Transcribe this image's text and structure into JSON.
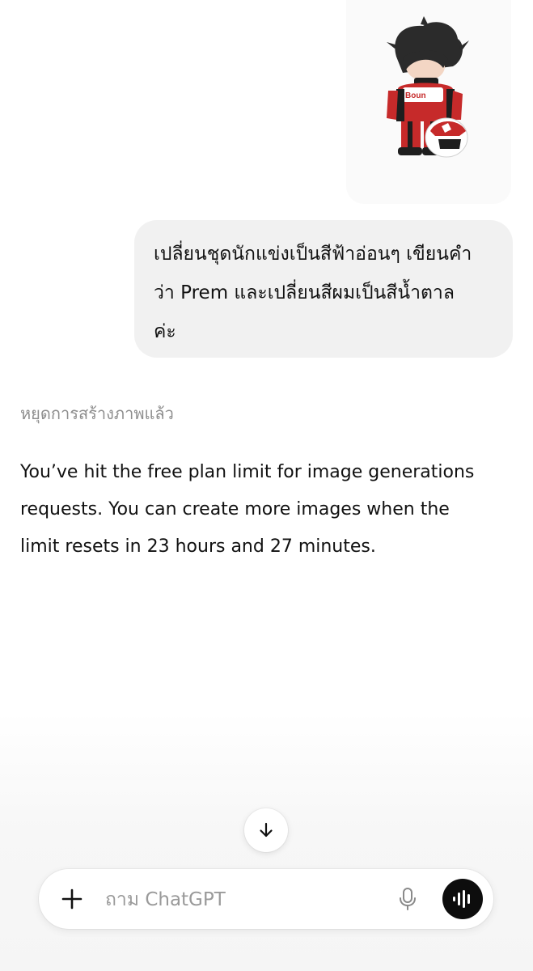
{
  "attachment": {
    "icon": "racer-sticker-image",
    "jersey_text": "Boun"
  },
  "user_message": {
    "lines": [
      "เปลี่ยนชุดนักแข่งเป็นสีฟ้าอ่อนๆ เขียนคำ",
      "ว่า Prem และเปลี่ยนสีผมเป็นสีน้ำตาล",
      "ค่ะ"
    ]
  },
  "assistant": {
    "status": "หยุดการสร้างภาพแล้ว",
    "reply_lines": [
      "You’ve hit the free plan limit for image generations",
      "requests. You can create more images when the",
      "limit resets in 23 hours and 27 minutes."
    ]
  },
  "scroll_button": {
    "icon": "arrow-down-icon"
  },
  "composer": {
    "placeholder": "ถาม ChatGPT",
    "plus_icon": "plus-icon",
    "mic_icon": "microphone-icon",
    "voice_icon": "voice-mode-icon"
  },
  "colors": {
    "bubble_bg": "#f1f1f1",
    "status_text": "#8e8e8e",
    "voice_button": "#0d0d0d"
  }
}
